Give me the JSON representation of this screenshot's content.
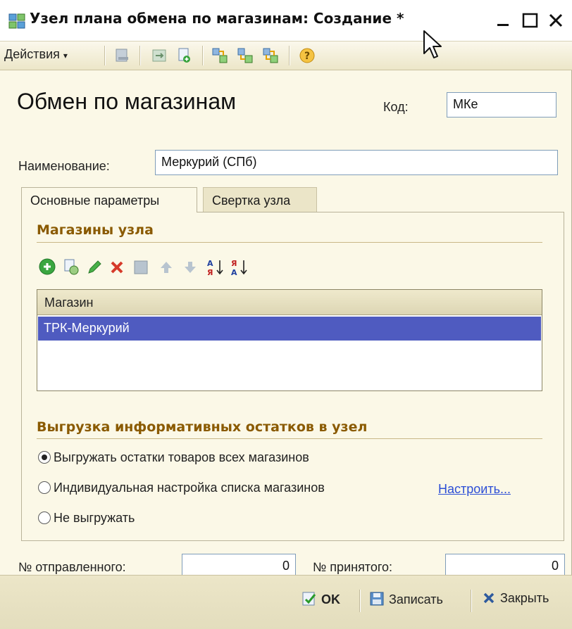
{
  "window": {
    "title": "Узел плана обмена по магазинам: Создание *"
  },
  "toolbar": {
    "actions_label": "Действия",
    "icons": [
      "post-icon",
      "refresh-icon",
      "copy-doc-icon",
      "exchange-icon-1",
      "exchange-icon-2",
      "exchange-icon-3",
      "help-icon"
    ]
  },
  "form": {
    "heading": "Обмен по магазинам",
    "code_label": "Код:",
    "code_value": "МКе",
    "name_label": "Наименование:",
    "name_value": "Меркурий (СПб)"
  },
  "tabs": [
    {
      "label": "Основные параметры",
      "active": true
    },
    {
      "label": "Свертка узла",
      "active": false
    }
  ],
  "shops_section": {
    "title": "Магазины узла",
    "column_header": "Магазин",
    "rows": [
      "ТРК-Меркурий"
    ]
  },
  "unload_section": {
    "title": "Выгрузка информативных остатков в узел",
    "options": [
      {
        "label": "Выгружать остатки товаров всех магазинов",
        "selected": true
      },
      {
        "label": "Индивидуальная настройка списка магазинов",
        "selected": false
      },
      {
        "label": "Не выгружать",
        "selected": false
      }
    ],
    "configure_link": "Настроить..."
  },
  "counters": {
    "sent_label": "№ отправленного:",
    "sent_value": "0",
    "received_label": "№ принятого:",
    "received_value": "0"
  },
  "bottom": {
    "ok_label": "OK",
    "save_label": "Записать",
    "close_label": "Закрыть"
  },
  "colors": {
    "window_bg": "#fbf8e7",
    "section_title": "#8a5a00",
    "selection": "#4f5bc0",
    "link": "#2c4ed6"
  }
}
